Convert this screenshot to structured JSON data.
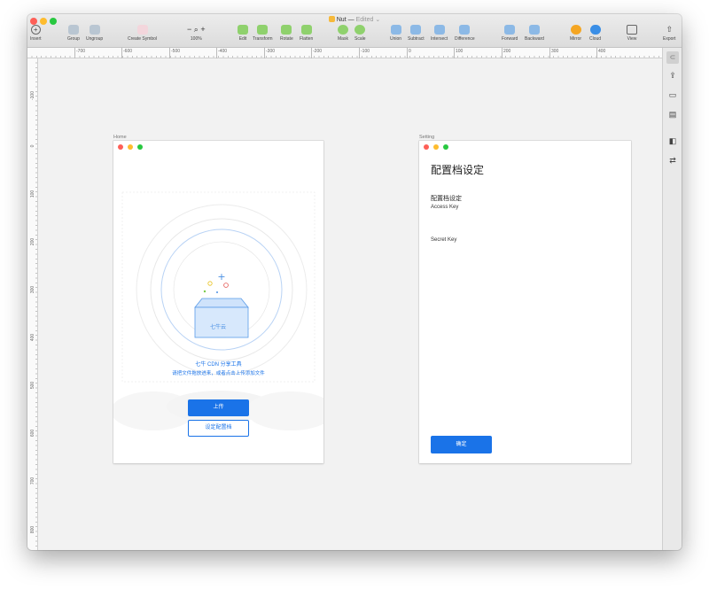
{
  "window": {
    "title": "Nut",
    "title_separator": "—",
    "status": "Edited",
    "colors": {
      "close": "#fe5f57",
      "minimize": "#febc2e",
      "zoom": "#28c840"
    }
  },
  "toolbar": {
    "insert": "Insert",
    "group": "Group",
    "ungroup": "Ungroup",
    "create_symbol": "Create Symbol",
    "zoom_minus": "−",
    "zoom_plus": "+",
    "zoom_value": "100%",
    "edit": "Edit",
    "transform": "Transform",
    "rotate": "Rotate",
    "flatten": "Flatten",
    "mask": "Mask",
    "scale": "Scale",
    "union": "Union",
    "subtract": "Subtract",
    "intersect": "Intersect",
    "difference": "Difference",
    "forward": "Forward",
    "backward": "Backward",
    "mirror": "Mirror",
    "cloud": "Cloud",
    "view": "View",
    "export": "Export"
  },
  "ruler": {
    "horizontal": [
      "-700",
      "-600",
      "-500",
      "-400",
      "-300",
      "-200",
      "-100",
      "0",
      "100",
      "200",
      "300",
      "400"
    ],
    "vertical": [
      "-100",
      "0",
      "100",
      "200",
      "300",
      "400",
      "500",
      "600",
      "700",
      "800"
    ]
  },
  "artboards": {
    "home": {
      "label": "Home",
      "app_name": "七牛 CDN 分享工具",
      "hint": "请把文件拖放进来，或者点击上传添加文件",
      "box_brand": "七牛云",
      "upload_button": "上传",
      "config_button": "设定配置档"
    },
    "setting": {
      "label": "Setting",
      "title": "配置档设定",
      "section_title": "配置档设定",
      "access_key_label": "Access Key",
      "secret_key_label": "Secret Key",
      "confirm_button": "确定"
    }
  },
  "colors": {
    "accent": "#1a73e8",
    "canvas": "#f2f2f2"
  }
}
